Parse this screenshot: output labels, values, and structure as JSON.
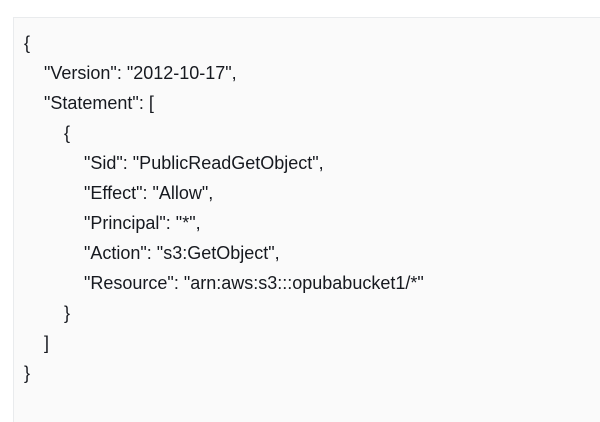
{
  "editor": {
    "lines": [
      "{",
      "  \"Version\": \"2012-10-17\",",
      "  \"Statement\": [",
      "    {",
      "      \"Sid\": \"PublicReadGetObject\",",
      "      \"Effect\": \"Allow\",",
      "      \"Principal\": \"*\",",
      "      \"Action\": \"s3:GetObject\",",
      "      \"Resource\": \"arn:aws:s3:::opubabucket1/*\"",
      "    }",
      "  ]",
      "}"
    ]
  }
}
